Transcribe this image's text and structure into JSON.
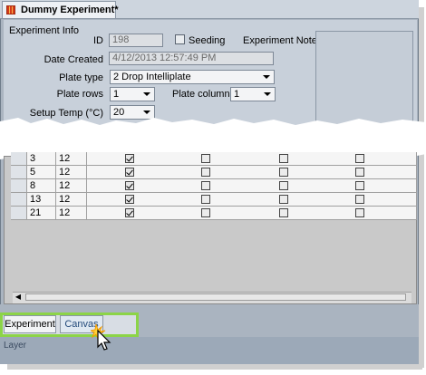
{
  "document_tab": {
    "title": "Dummy Experiment*"
  },
  "experiment_info": {
    "group_label": "Experiment Info",
    "id_label": "ID",
    "id_value": "198",
    "seeding_label": "Seeding",
    "notes_label": "Experiment Notes",
    "date_label": "Date Created",
    "date_value": "4/12/2013 12:57:49 PM",
    "plate_type_label": "Plate type",
    "plate_type_value": "2 Drop Intelliplate",
    "plate_rows_label": "Plate rows",
    "plate_rows_value": "1",
    "plate_columns_label": "Plate columns",
    "plate_columns_value": "1",
    "setup_temp_label": "Setup Temp (°C)",
    "setup_temp_value": "20"
  },
  "grid": {
    "rows": [
      {
        "label": "3",
        "value": "12",
        "checks": [
          true,
          false,
          false,
          false
        ]
      },
      {
        "label": "5",
        "value": "12",
        "checks": [
          true,
          false,
          false,
          false
        ]
      },
      {
        "label": "8",
        "value": "12",
        "checks": [
          true,
          false,
          false,
          false
        ]
      },
      {
        "label": "13",
        "value": "12",
        "checks": [
          true,
          false,
          false,
          false
        ]
      },
      {
        "label": "21",
        "value": "12",
        "checks": [
          true,
          false,
          false,
          false
        ]
      }
    ]
  },
  "bottom_tabs": {
    "experiment": "Experiment",
    "canvas": "Canvas"
  },
  "layer_label": "Layer",
  "colors": {
    "highlight": "#8cd448",
    "panel": "#c8d0da"
  }
}
